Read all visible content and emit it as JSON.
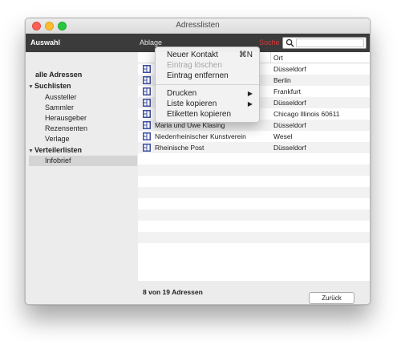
{
  "window": {
    "title": "Adresslisten"
  },
  "toolbar": {
    "selection_label": "Auswahl",
    "file_menu_label": "Ablage",
    "search_label": "Suche",
    "search_value": ""
  },
  "sidebar": {
    "all_label": "alle Adressen",
    "groups": [
      {
        "label": "Suchlisten",
        "items": [
          "Aussteller",
          "Sammler",
          "Herausgeber",
          "Rezensenten",
          "Verlage"
        ]
      },
      {
        "label": "Verteilerlisten",
        "items": [
          "Infobrief"
        ]
      }
    ],
    "selected_item": "Infobrief"
  },
  "table": {
    "columns": [
      "",
      "Ort"
    ],
    "rows": [
      {
        "name": "",
        "city": "Düsseldorf"
      },
      {
        "name": "",
        "city": "Berlin"
      },
      {
        "name": "",
        "city": "Frankfurt"
      },
      {
        "name": "",
        "city": "Düsseldorf"
      },
      {
        "name": "",
        "city": "Chicago Illinois 60611"
      },
      {
        "name": "Maria und Uwe Klasing",
        "city": "Düsseldorf"
      },
      {
        "name": "Niederrheinischer Kunstverein",
        "city": "Wesel"
      },
      {
        "name": "Rheinische Post",
        "city": "Düsseldorf"
      }
    ]
  },
  "footer": {
    "count_text": "8 von 19 Adressen",
    "back_label": "Zurück"
  },
  "context_menu": {
    "items": [
      {
        "label": "Neuer Kontakt",
        "shortcut": "⌘N",
        "enabled": true
      },
      {
        "label": "Eintrag löschen",
        "enabled": false
      },
      {
        "label": "Eintrag entfernen",
        "enabled": true
      },
      {
        "label": "Drucken",
        "submenu": true,
        "enabled": true
      },
      {
        "label": "Liste kopieren",
        "submenu": true,
        "enabled": true
      },
      {
        "label": "Etiketten kopieren",
        "enabled": true
      }
    ]
  },
  "colors": {
    "toolbar": "#3b3b3b",
    "search_label": "#d43a3a",
    "row_icon": "#3e4fa0"
  }
}
